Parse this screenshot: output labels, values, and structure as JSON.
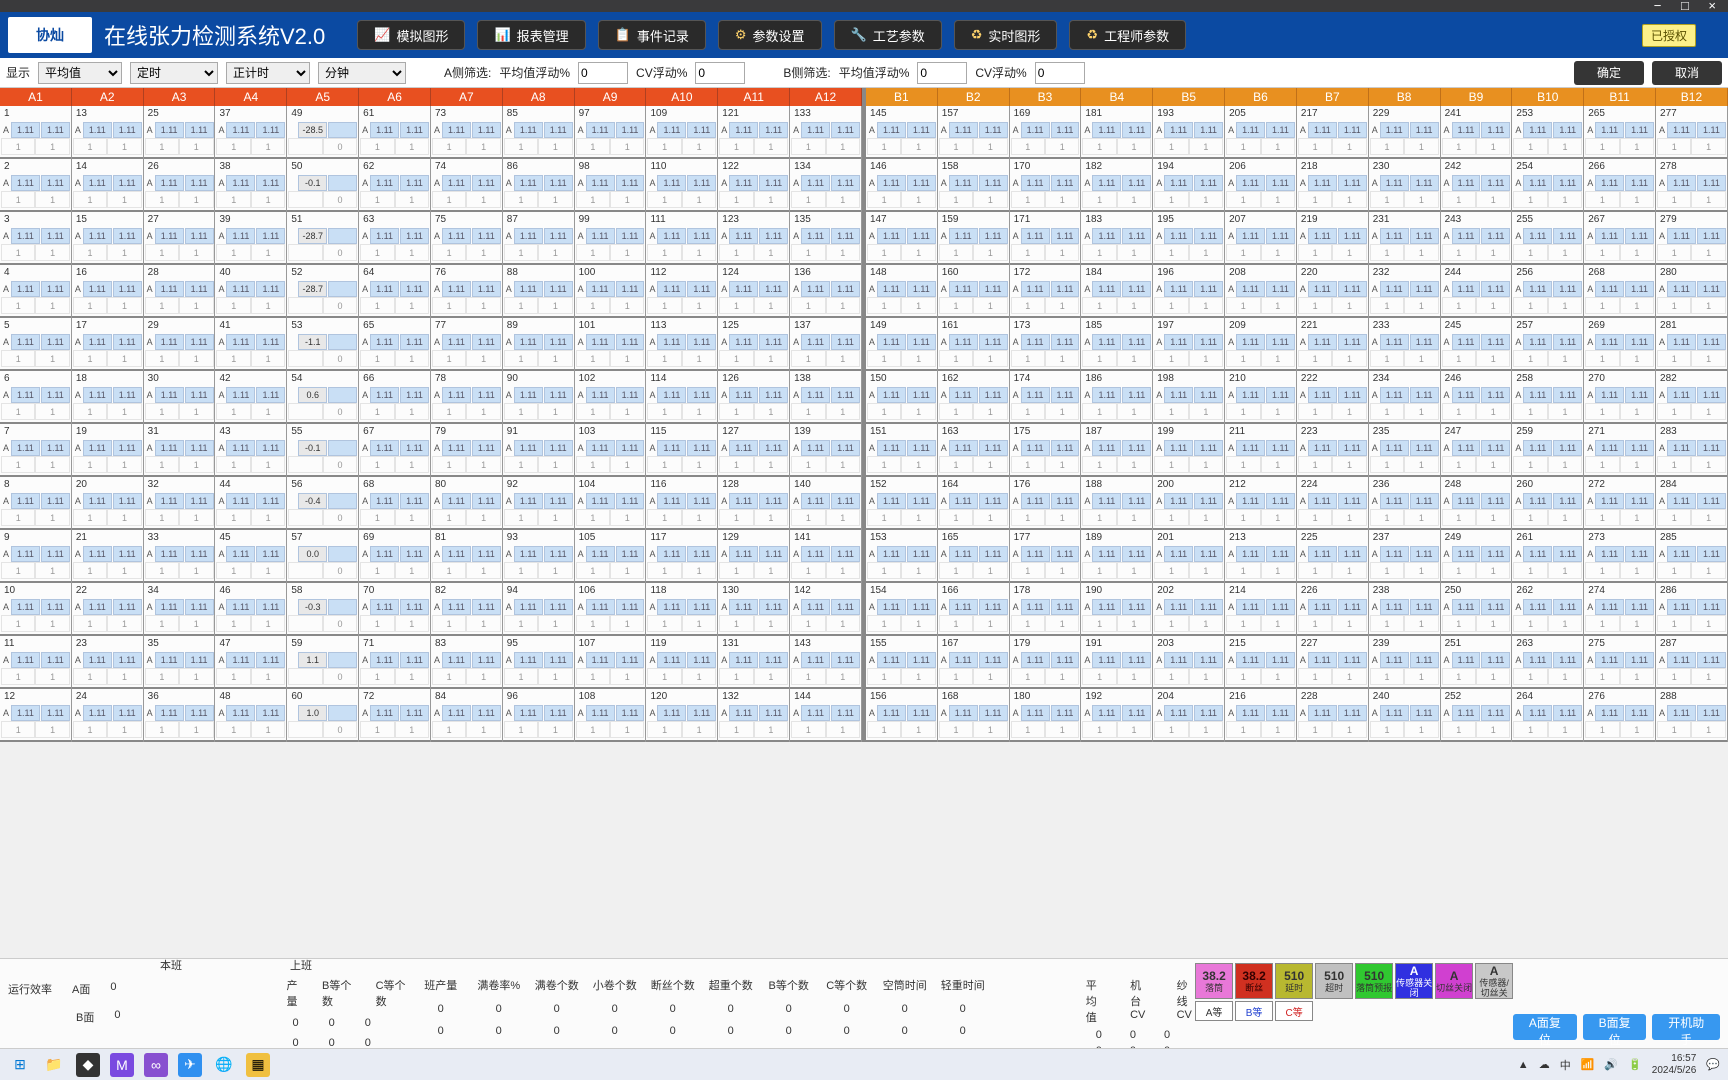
{
  "window": {
    "title_bar_controls": "−  □  ×"
  },
  "header": {
    "logo_text": "协灿",
    "app_title": "在线张力检测系统V2.0",
    "buttons": {
      "simulate": "模拟图形",
      "report": "报表管理",
      "events": "事件记录",
      "params": "参数设置",
      "process": "工艺参数",
      "realtime": "实时图形",
      "engineer": "工程师参数"
    },
    "license": "已授权"
  },
  "filter": {
    "display_lbl": "显示",
    "display_val": "平均值",
    "timing_val": "定时",
    "count_val": "正计时",
    "unit_val": "分钟",
    "a_side_lbl": "A侧筛选:",
    "avg_float_lbl": "平均值浮动%",
    "a_avg_val": "0",
    "cv_float_lbl": "CV浮动%",
    "a_cv_val": "0",
    "b_side_lbl": "B侧筛选:",
    "b_avg_val": "0",
    "b_cv_val": "0",
    "ok_btn": "确定",
    "cancel_btn": "取消"
  },
  "columns_a": [
    "A1",
    "A2",
    "A3",
    "A4",
    "A5",
    "A6",
    "A7",
    "A8",
    "A9",
    "A10",
    "A11",
    "A12"
  ],
  "columns_b": [
    "B1",
    "B2",
    "B3",
    "B4",
    "B5",
    "B6",
    "B7",
    "B8",
    "B9",
    "B10",
    "B11",
    "B12"
  ],
  "rows": 12,
  "cell_default": {
    "label": "A",
    "v1": "1.11",
    "v2": "1.11",
    "s1": "1",
    "s2": "1"
  },
  "a5_special": [
    {
      "idx": 49,
      "v": "-28.5",
      "s": "0"
    },
    {
      "idx": 50,
      "v": "-0.1",
      "s": "0"
    },
    {
      "idx": 51,
      "v": "-28.7",
      "s": "0"
    },
    {
      "idx": 52,
      "v": "-28.7",
      "s": "0"
    },
    {
      "idx": 53,
      "v": "-1.1",
      "s": "0"
    },
    {
      "idx": 54,
      "v": "0.6",
      "s": "0"
    },
    {
      "idx": 55,
      "v": "-0.1",
      "s": "0"
    },
    {
      "idx": 56,
      "v": "-0.4",
      "s": "0"
    },
    {
      "idx": 57,
      "v": "0.0",
      "s": "0"
    },
    {
      "idx": 58,
      "v": "-0.3",
      "s": "0"
    },
    {
      "idx": 59,
      "v": "1.1",
      "s": "0"
    },
    {
      "idx": 60,
      "v": "1.0",
      "s": "0"
    }
  ],
  "footer": {
    "shift_cur": "本班",
    "shift_prev": "上班",
    "run_eff": "运行效率",
    "a_face": "A面",
    "b_face": "B面",
    "a_val": "0",
    "b_val": "0",
    "stats_hdr": [
      "产量",
      "B等个数",
      "C等个数"
    ],
    "stats_vals": [
      "0",
      "0",
      "0"
    ],
    "stats2_hdr": [
      "班产量",
      "满卷率%",
      "满卷个数",
      "小卷个数",
      "断丝个数",
      "超重个数",
      "B等个数",
      "C等个数",
      "空筒时间",
      "轻重时间"
    ],
    "stats2_row": [
      "0",
      "0",
      "0",
      "0",
      "0",
      "0",
      "0",
      "0",
      "0",
      "0"
    ],
    "right_hdr": [
      "平均值",
      "机台CV",
      "纱线CV"
    ],
    "right_row": [
      "0",
      "0",
      "0"
    ],
    "legend": [
      {
        "t": "38.2",
        "b": "落筒",
        "bg": "#e878d8"
      },
      {
        "t": "38.2",
        "b": "断丝",
        "bg": "#d03020",
        "fg": "#300"
      },
      {
        "t": "510",
        "b": "延时",
        "bg": "#b8b830"
      },
      {
        "t": "510",
        "b": "超时",
        "bg": "#c0c0c0"
      },
      {
        "t": "510",
        "b": "落筒预报",
        "bg": "#30c830"
      },
      {
        "t": "A",
        "b": "传感器关闭",
        "bg": "#3030e0",
        "fg": "#fff"
      },
      {
        "t": "A",
        "b": "切丝关闭",
        "bg": "#d040d0"
      },
      {
        "t": "A",
        "b": "传感器/切丝关",
        "bg": "#c8c8c8"
      }
    ],
    "legend2": [
      "A等",
      "B等",
      "C等"
    ],
    "btn_a_reset": "A面复位",
    "btn_b_reset": "B面复位",
    "btn_helper": "开机助手"
  },
  "taskbar": {
    "time": "16:57",
    "date": "2024/5/26"
  }
}
